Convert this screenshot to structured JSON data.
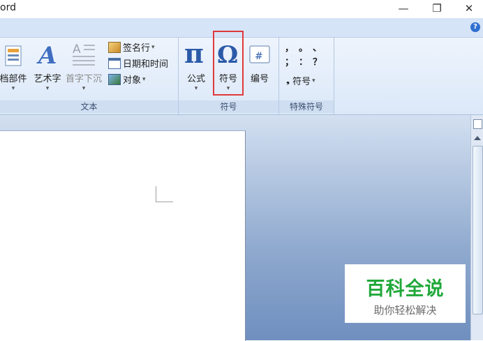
{
  "window": {
    "title": "ord",
    "minimize": "—",
    "restore": "❐",
    "close": "✕"
  },
  "help_label": "?",
  "ribbon": {
    "groups": {
      "text": {
        "label": "文本"
      },
      "symbols": {
        "label": "符号"
      },
      "special": {
        "label": "特殊符号"
      }
    },
    "buttons": {
      "doc_parts": "档部件",
      "wordart": "艺术字",
      "dropcap": "首字下沉",
      "signature": "签名行",
      "datetime": "日期和时间",
      "object": "对象",
      "formula": "公式",
      "symbol": "符号",
      "numbering": "编号",
      "special_symbol": "符号"
    },
    "arrow": "▾",
    "special_chars": [
      "，",
      "。",
      "、",
      "；",
      "：",
      "？"
    ],
    "special_bullet": "❟"
  },
  "watermark": {
    "main": "百科全说",
    "sub": "助你轻松解决"
  },
  "icons": [
    "document-parts-icon",
    "wordart-icon",
    "dropcap-icon",
    "signature-icon",
    "datetime-icon",
    "object-icon",
    "pi-icon",
    "omega-icon",
    "number-icon"
  ]
}
